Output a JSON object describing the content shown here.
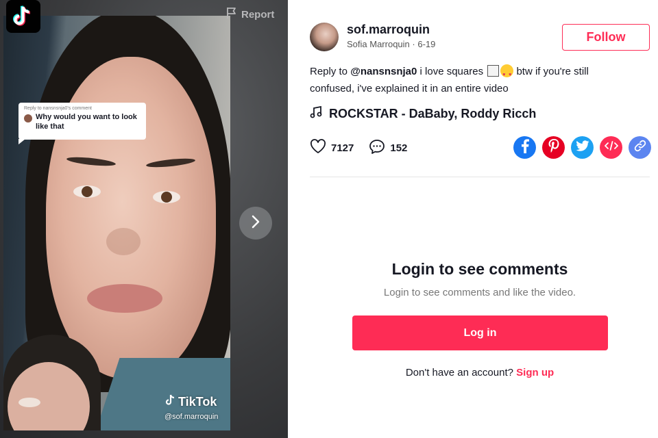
{
  "video": {
    "report_label": "Report",
    "reply_caption": "Reply to nansnsnja0's comment",
    "reply_comment": "Why would you want to look like that",
    "watermark_brand": "TikTok",
    "watermark_handle": "@sof.marroquin"
  },
  "author": {
    "username": "sof.marroquin",
    "display_name": "Sofia Marroquin",
    "date": "6-19",
    "follow_label": "Follow"
  },
  "caption": {
    "prefix": "Reply to",
    "mention": "@nansnsnja0",
    "text_before_emoji": "i love squares",
    "text_after_emoji": "btw if you're still confused, i've explained it in an entire video"
  },
  "music": {
    "title": "ROCKSTAR - DaBaby, Roddy Ricch"
  },
  "stats": {
    "likes": "7127",
    "comments": "152"
  },
  "share_icons": [
    "facebook-icon",
    "pinterest-icon",
    "twitter-icon",
    "embed-icon",
    "link-icon"
  ],
  "colors": {
    "accent": "#fe2c55",
    "facebook": "#1877f2",
    "pinterest": "#e60023",
    "twitter": "#1da1f2",
    "embed": "#fe2c55",
    "link": "#5c85f0"
  },
  "comments_gate": {
    "title": "Login to see comments",
    "subtitle": "Login to see comments and like the video.",
    "login_label": "Log in",
    "no_account_text": "Don't have an account?",
    "signup_label": "Sign up"
  }
}
